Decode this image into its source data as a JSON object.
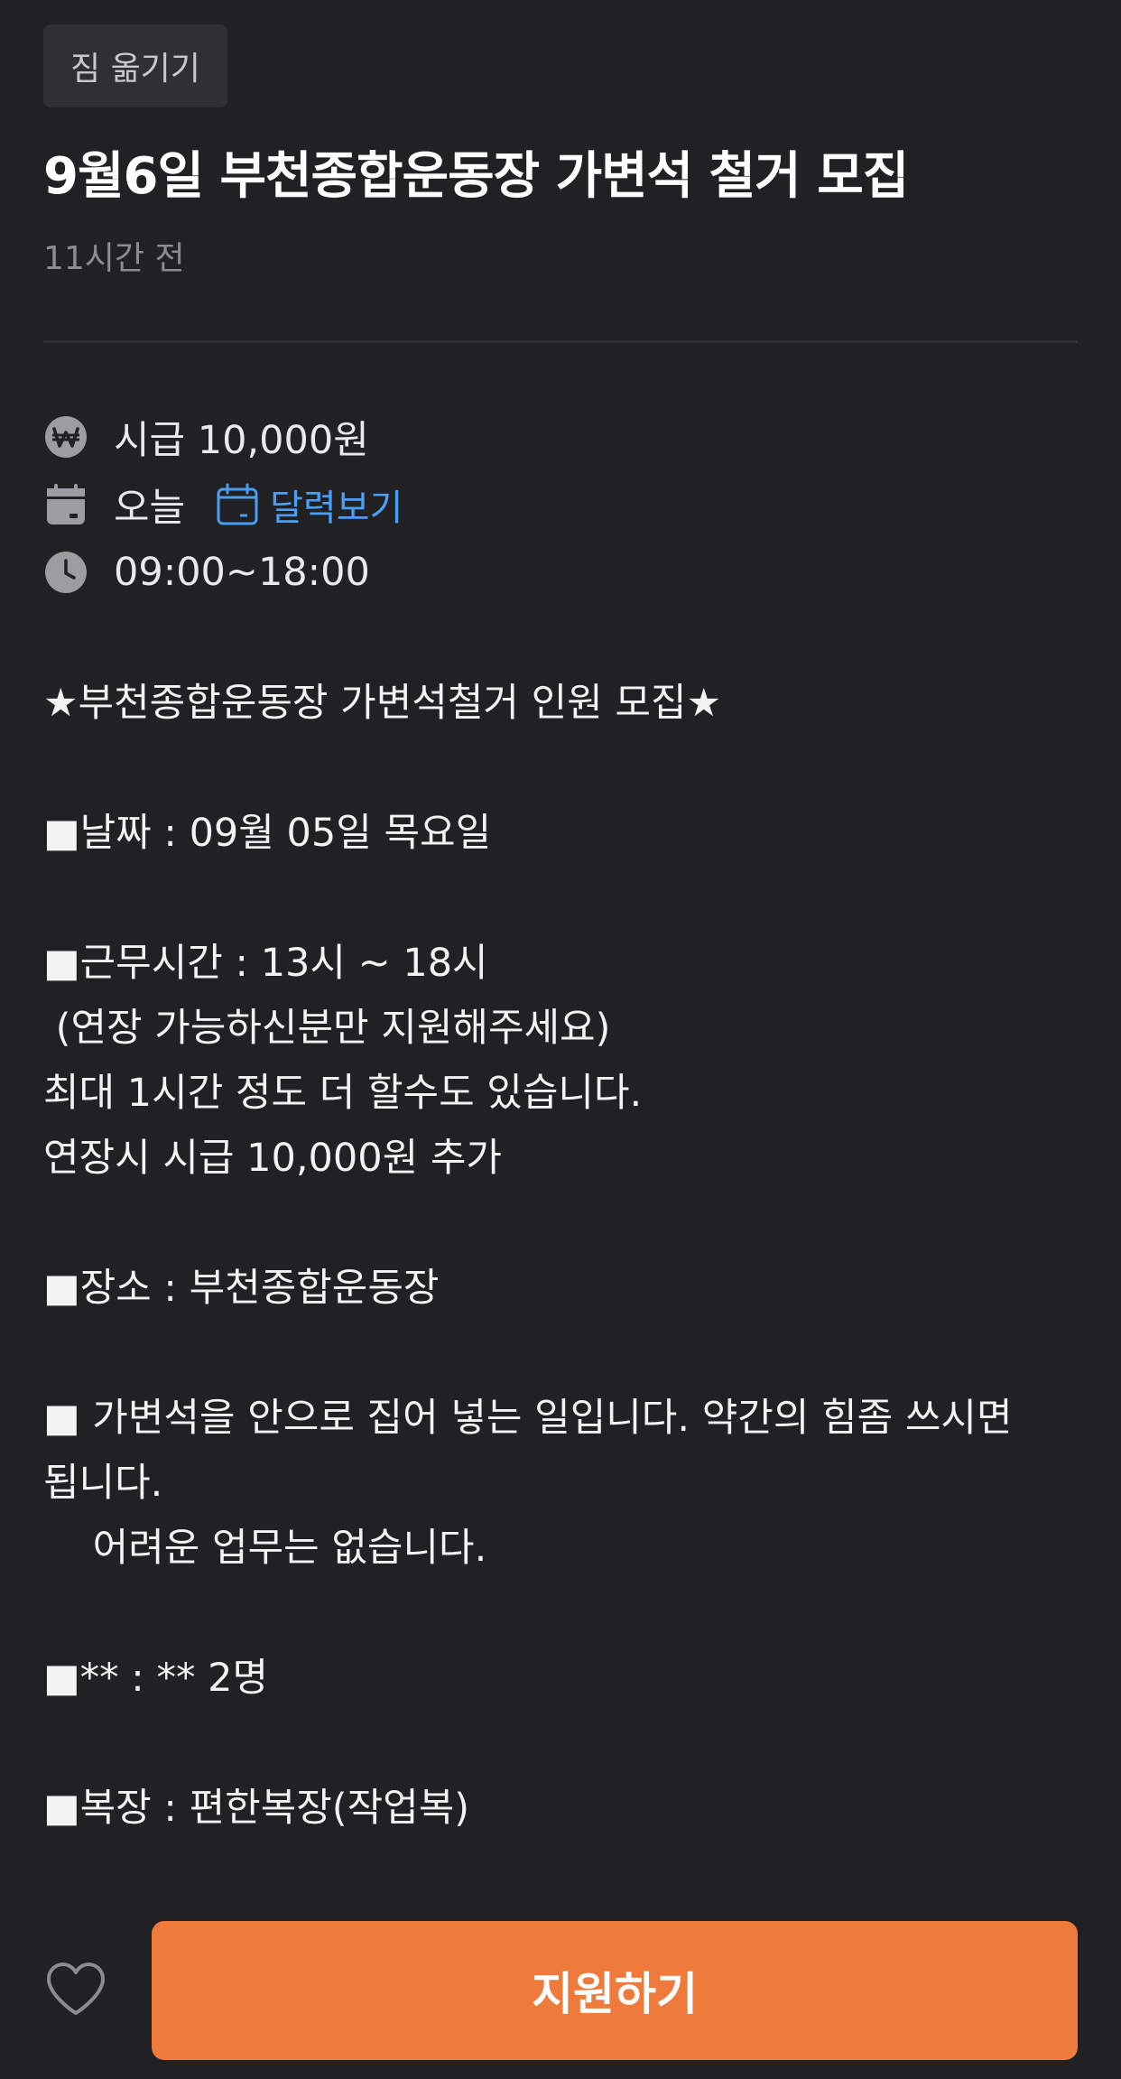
{
  "category": "짐 옮기기",
  "title": "9월6일 부천종합운동장 가변석 철거 모집",
  "time_ago": "11시간 전",
  "info": {
    "wage": "시급 10,000원",
    "date": "오늘",
    "calendar_link": "달력보기",
    "hours": "09:00~18:00"
  },
  "description": [
    "★부천종합운동장 가변석철거 인원 모집★",
    "",
    "■날짜 : 09월 05일 목요일",
    "",
    "■근무시간 : 13시 ~ 18시",
    " (연장 가능하신분만 지원해주세요)",
    "최대 1시간 정도 더 할수도 있습니다.",
    "연장시 시급 10,000원 추가",
    "",
    "■장소 : 부천종합운동장",
    "",
    "■ 가변석을 안으로 집어 넣는 일입니다. 약간의 힘좀 쓰시면",
    "됩니다.",
    "    어려운 업무는 없습니다.",
    "",
    "■** : ** 2명",
    "",
    "■복장 : 편한복장(작업복)"
  ],
  "apply_button": "지원하기",
  "colors": {
    "background": "#212124",
    "accent": "#ee7a3b",
    "link": "#4a9ff5"
  },
  "icons": {
    "wage": "won-circle-icon",
    "date": "calendar-icon",
    "calendar_link": "calendar-outline-icon",
    "hours": "clock-icon",
    "favorite": "heart-outline-icon"
  }
}
